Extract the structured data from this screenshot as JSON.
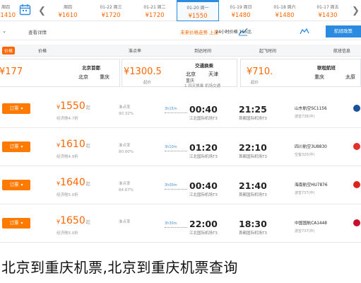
{
  "date_strip": {
    "prev_arrow": "❮",
    "next_arrow": "❯",
    "days": [
      {
        "date": "01-22 周三",
        "price": "¥1720"
      },
      {
        "date": "01-21 周二",
        "price": "¥1720"
      },
      {
        "date": "01-20 周一",
        "price": "¥1550"
      },
      {
        "date": "01-19 周日",
        "price": "¥1480"
      },
      {
        "date": "01-18 周六",
        "price": "¥1480"
      },
      {
        "date": "01-17 周五",
        "price": "¥1430"
      }
    ],
    "first_partial": {
      "date": "周四",
      "price": "¥1610"
    },
    "left_partial": {
      "price": "¥1410"
    }
  },
  "filters": {
    "view_detail": "查看详情",
    "trend": "未来价格走势 上涨",
    "lowest": "24小时价格 155比",
    "nav_tag": "航班政策"
  },
  "columns": {
    "badge": "价格",
    "c1": "价格",
    "c2": "准点率",
    "c3": "到达时间",
    "c4": "起飞时间",
    "c5": "航班信息"
  },
  "cards": [
    {
      "title": "北京首都",
      "from": "北京",
      "to": "重庆",
      "price": "¥1300.5",
      "note": "起价",
      "prefix": "¥177"
    },
    {
      "title": "交通换乘",
      "from": "北京",
      "to": "天津",
      "via": "重庆",
      "price": "¥710.",
      "note": "起价",
      "remark": "1 四天换乘 机场交通"
    },
    {
      "title": "联程航班",
      "from": "太原",
      "to": "重庆",
      "price": "¥710.",
      "note": "起价"
    }
  ],
  "flights": [
    {
      "book": "订票",
      "price": "1550",
      "sub": "经济舱4.7折",
      "rate": "准点率",
      "rate_val": "90.32%",
      "arr": "00:40",
      "arr_ap": "江北国际机场T3",
      "dur": "3h15m",
      "dep": "21:25",
      "dep_ap": "首都国际机场T3",
      "airline": "山东航空SC1156",
      "fno": "波音738(中)",
      "hot": ""
    },
    {
      "book": "订票",
      "price": "1610",
      "sub": "经济舱4.9折",
      "rate": "准点率",
      "rate_val": "80.00%",
      "arr": "01:20",
      "arr_ap": "江北国际机场T3",
      "dur": "3h10m",
      "dep": "22:10",
      "dep_ap": "首都国际机场T3",
      "airline": "四川航空3U8830",
      "fno": "空客320(中)",
      "hot": ""
    },
    {
      "book": "订票",
      "price": "1640",
      "sub": "经济舱5.0折",
      "rate": "准点率",
      "rate_val": "84.67%",
      "arr": "00:40",
      "arr_ap": "江北国际机场T3",
      "dur": "3h00m",
      "dep": "21:40",
      "dep_ap": "首都国际机场T3",
      "airline": "海南航空HU7876",
      "fno": "波音737(中)",
      "hot": ""
    },
    {
      "book": "订票",
      "price": "1650",
      "sub": "经济舱5.0折",
      "rate": "准点率",
      "rate_val": "",
      "arr": "22:00",
      "arr_ap": "江北国际机场T3",
      "dur": "3h30m",
      "dep": "18:30",
      "dep_ap": "首都国际机场T3",
      "airline": "中国国航CA1448",
      "fno": "波音737(中)",
      "hot": ""
    }
  ],
  "caption": "北京到重庆机票,北京到重庆机票查询",
  "colors": {
    "accent": "#2b8be0",
    "price": "#ff6600",
    "book": "#ff7a00"
  }
}
